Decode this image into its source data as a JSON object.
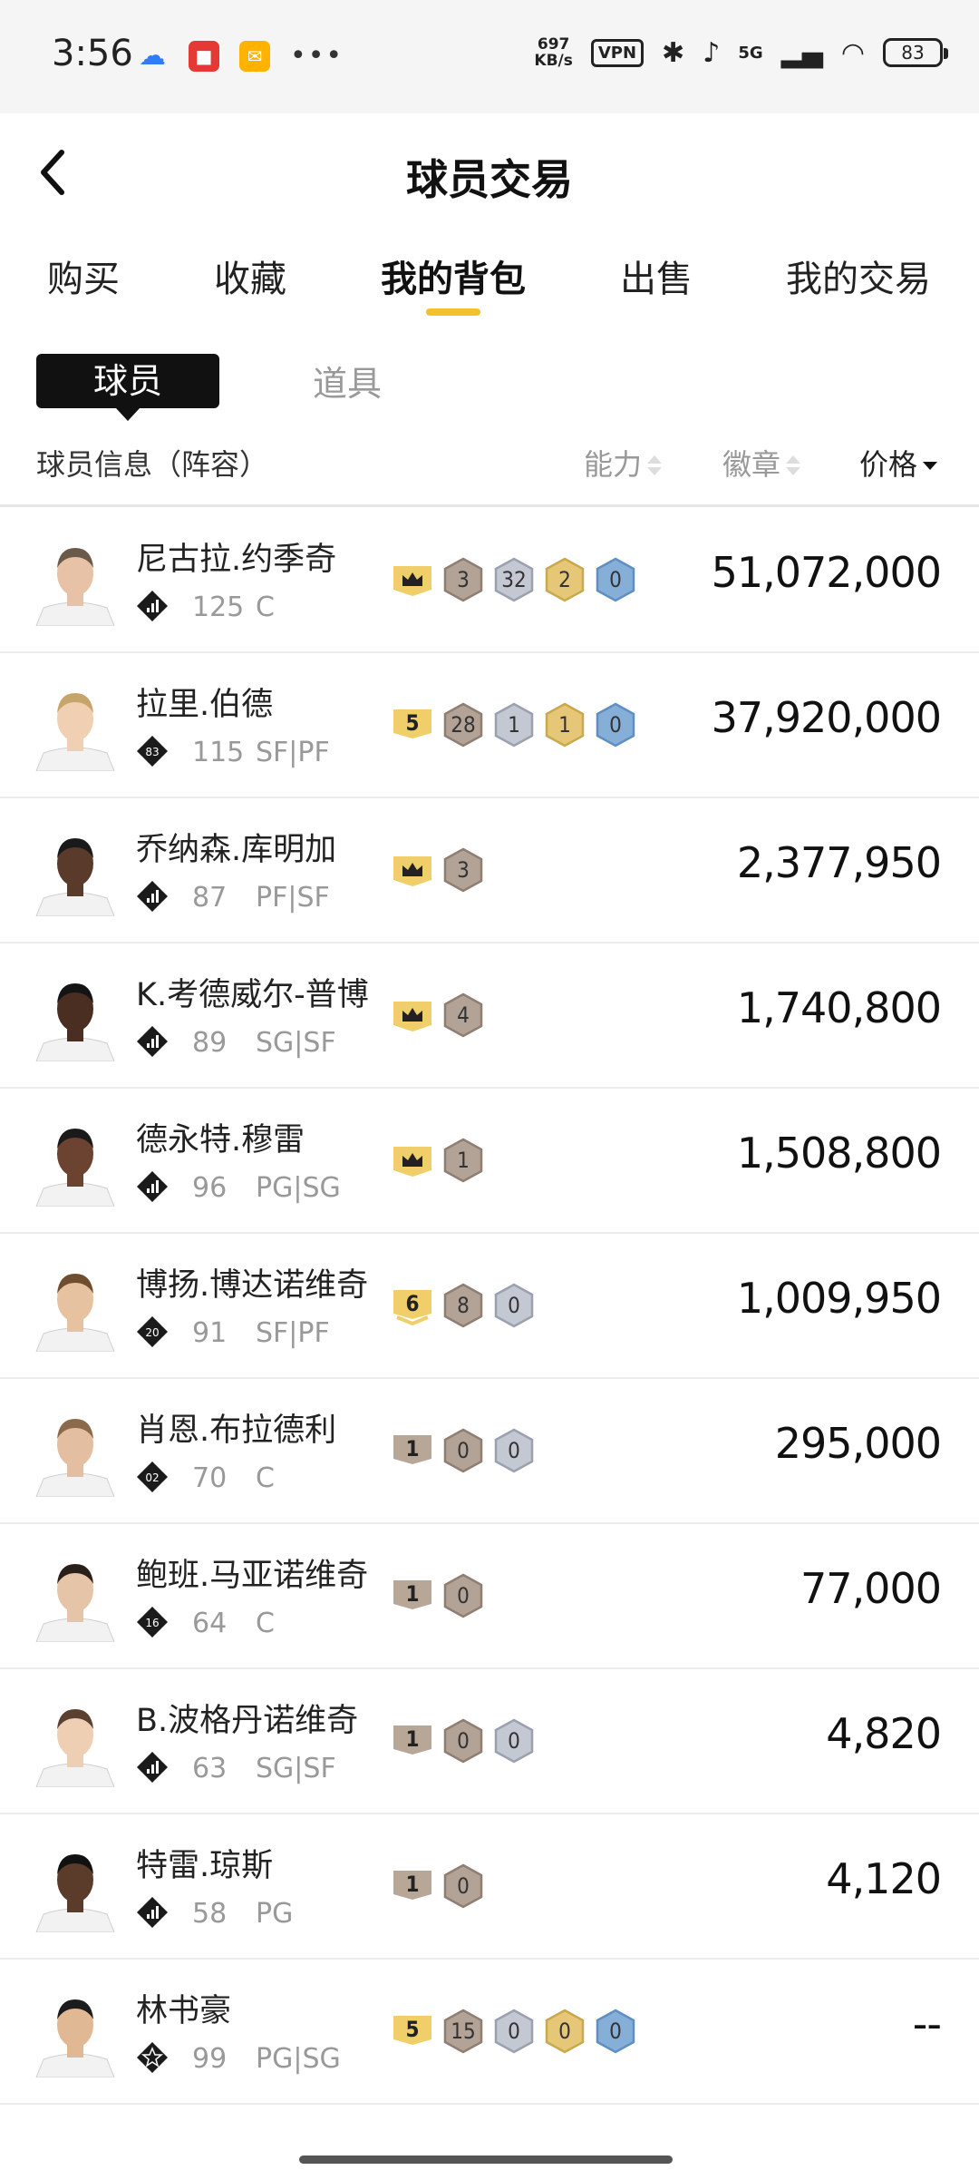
{
  "status_bar": {
    "time": "3:56",
    "left_icons": [
      "cloud-sync-icon",
      "app-red-icon",
      "mail-icon"
    ],
    "more": "•••",
    "net_speed_value": "697",
    "net_speed_unit": "KB/s",
    "vpn": "VPN",
    "network": "5G",
    "battery": "83"
  },
  "header": {
    "title": "球员交易"
  },
  "tabs": {
    "t0": "购买",
    "t1": "收藏",
    "t2": "我的背包",
    "t3": "出售",
    "t4": "我的交易",
    "active": "我的背包"
  },
  "sub_tabs": {
    "s0": "球员",
    "s1": "道具",
    "active": "球员"
  },
  "columns": {
    "info": "球员信息（阵容）",
    "ability": "能力",
    "badge": "徽章",
    "price": "价格"
  },
  "colors": {
    "accent": "#f2c12e",
    "gold": "#f0cf6a",
    "bronze": "#b8a697",
    "silver": "#c8ccd6",
    "blue": "#8ab4dc"
  },
  "players": [
    {
      "name": "尼古拉.约季奇",
      "tier": "bars",
      "rating": "125",
      "pos": "C",
      "badges": [
        {
          "t": "crown"
        },
        {
          "t": "bronze",
          "v": "3"
        },
        {
          "t": "silver",
          "v": "32"
        },
        {
          "t": "gold",
          "v": "2"
        },
        {
          "t": "blue",
          "v": "0"
        }
      ],
      "price": "51,072,000"
    },
    {
      "name": "拉里.伯德",
      "tier": "83",
      "rating": "115",
      "pos": "SF|PF",
      "badges": [
        {
          "t": "level",
          "v": "5"
        },
        {
          "t": "bronze",
          "v": "28"
        },
        {
          "t": "silver",
          "v": "1"
        },
        {
          "t": "gold",
          "v": "1"
        },
        {
          "t": "blue",
          "v": "0"
        }
      ],
      "price": "37,920,000"
    },
    {
      "name": "乔纳森.库明加",
      "tier": "bars",
      "rating": "87",
      "pos": "PF|SF",
      "badges": [
        {
          "t": "crown"
        },
        {
          "t": "bronze",
          "v": "3"
        }
      ],
      "price": "2,377,950"
    },
    {
      "name": "K.考德威尔-普博",
      "tier": "bars",
      "rating": "89",
      "pos": "SG|SF",
      "badges": [
        {
          "t": "crown"
        },
        {
          "t": "bronze",
          "v": "4"
        }
      ],
      "price": "1,740,800"
    },
    {
      "name": "德永特.穆雷",
      "tier": "bars",
      "rating": "96",
      "pos": "PG|SG",
      "badges": [
        {
          "t": "crown"
        },
        {
          "t": "bronze",
          "v": "1"
        }
      ],
      "price": "1,508,800"
    },
    {
      "name": "博扬.博达诺维奇",
      "tier": "20",
      "rating": "91",
      "pos": "SF|PF",
      "badges": [
        {
          "t": "level6",
          "v": "6"
        },
        {
          "t": "bronze",
          "v": "8"
        },
        {
          "t": "silver",
          "v": "0"
        }
      ],
      "price": "1,009,950"
    },
    {
      "name": "肖恩.布拉德利",
      "tier": "02",
      "rating": "70",
      "pos": "C",
      "badges": [
        {
          "t": "levelb",
          "v": "1"
        },
        {
          "t": "bronze",
          "v": "0"
        },
        {
          "t": "silver",
          "v": "0"
        }
      ],
      "price": "295,000"
    },
    {
      "name": "鲍班.马亚诺维奇",
      "tier": "16",
      "rating": "64",
      "pos": "C",
      "badges": [
        {
          "t": "levelb",
          "v": "1"
        },
        {
          "t": "bronze",
          "v": "0"
        }
      ],
      "price": "77,000"
    },
    {
      "name": "B.波格丹诺维奇",
      "tier": "bars",
      "rating": "63",
      "pos": "SG|SF",
      "badges": [
        {
          "t": "levelb",
          "v": "1"
        },
        {
          "t": "bronze",
          "v": "0"
        },
        {
          "t": "silver",
          "v": "0"
        }
      ],
      "price": "4,820"
    },
    {
      "name": "特雷.琼斯",
      "tier": "bars",
      "rating": "58",
      "pos": "PG",
      "badges": [
        {
          "t": "levelb",
          "v": "1"
        },
        {
          "t": "bronze",
          "v": "0"
        }
      ],
      "price": "4,120"
    },
    {
      "name": "林书豪",
      "tier": "star",
      "rating": "99",
      "pos": "PG|SG",
      "badges": [
        {
          "t": "level",
          "v": "5"
        },
        {
          "t": "bronze",
          "v": "15"
        },
        {
          "t": "silver",
          "v": "0"
        },
        {
          "t": "gold",
          "v": "0"
        },
        {
          "t": "blue",
          "v": "0"
        }
      ],
      "price": "--"
    }
  ]
}
